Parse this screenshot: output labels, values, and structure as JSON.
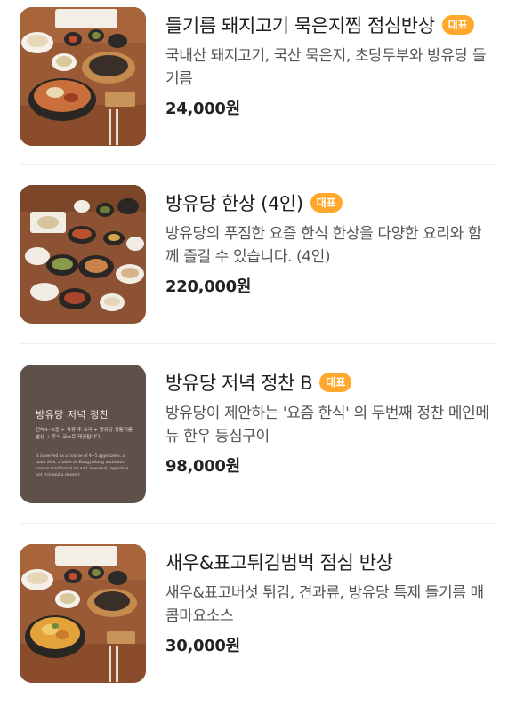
{
  "badge_label": "대표",
  "items": [
    {
      "name": "들기름 돼지고기 묵은지찜 점심반상",
      "desc": "국내산 돼지고기, 국산 묵은지, 초당두부와 방유당 들기름",
      "price": "24,000원",
      "image": "lunch-set-photo"
    },
    {
      "name": "방유당 한상 (4인)",
      "desc": "방유당의 푸짐한 요즘 한식 한상을 다양한 요리와 함께 즐길 수 있습니다. (4인)",
      "price": "220,000원",
      "image": "table-spread-photo"
    },
    {
      "name": "방유당 저녁 정찬 B",
      "desc": "방유당이 제안하는 '요즘 한식' 의 두번째 정찬 메인메뉴 한우 등심구이",
      "price": "98,000원",
      "image": "dinner-course-card",
      "card": {
        "title": "방유당 저녁 정찬",
        "sub": "전채4~5종 + 육류 주 요리 + 방유당 정통기름 밥상 + 후식 코스로 제공됩니다.",
        "en": "It is served as a course of 4~5 appetizers, a main dish, a table as Bangyudang authentic korean traditional oil and 'seasonal vegetable pot rice and a dessert"
      }
    },
    {
      "name": "새우&표고튀김범벅 점심 반상",
      "desc": "새우&표고버섯 튀김, 견과류, 방유당 특제 들기름 매콤마요소스",
      "price": "30,000원",
      "image": "shrimp-lunch-photo"
    }
  ]
}
